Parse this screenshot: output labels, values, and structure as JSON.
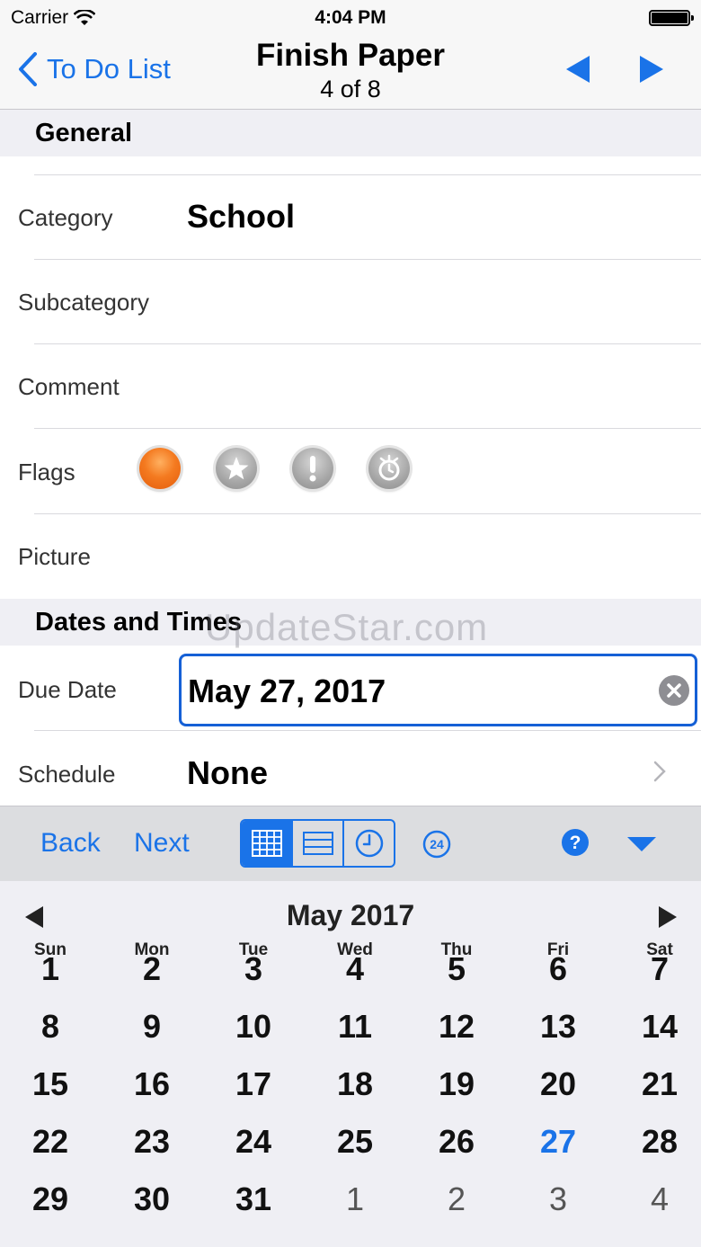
{
  "status": {
    "carrier": "Carrier",
    "time": "4:04 PM"
  },
  "nav": {
    "back_label": "To Do List",
    "title": "Finish Paper",
    "subtitle": "4 of 8"
  },
  "sections": {
    "general": "General",
    "dates": "Dates and Times"
  },
  "fields": {
    "category": {
      "label": "Category",
      "value": "School"
    },
    "subcategory": {
      "label": "Subcategory",
      "value": ""
    },
    "comment": {
      "label": "Comment",
      "value": ""
    },
    "flags": {
      "label": "Flags",
      "icons": [
        "orange-flag-icon",
        "star-flag-icon",
        "exclamation-flag-icon",
        "alarm-flag-icon"
      ]
    },
    "picture": {
      "label": "Picture"
    },
    "due_date": {
      "label": "Due Date",
      "value": "May 27, 2017"
    },
    "schedule": {
      "label": "Schedule",
      "value": "None"
    }
  },
  "watermark": "UpdateStar.com",
  "toolbar": {
    "back": "Back",
    "next": "Next",
    "active_view": "month-grid"
  },
  "calendar": {
    "month": "May 2017",
    "weekdays": [
      "Sun",
      "Mon",
      "Tue",
      "Wed",
      "Thu",
      "Fri",
      "Sat"
    ],
    "weeks": [
      [
        "1",
        "2",
        "3",
        "4",
        "5",
        "6",
        "7"
      ],
      [
        "8",
        "9",
        "10",
        "11",
        "12",
        "13",
        "14"
      ],
      [
        "15",
        "16",
        "17",
        "18",
        "19",
        "20",
        "21"
      ],
      [
        "22",
        "23",
        "24",
        "25",
        "26",
        "27",
        "28"
      ],
      [
        "29",
        "30",
        "31",
        "1",
        "2",
        "3",
        "4"
      ]
    ],
    "selected": "27"
  },
  "colors": {
    "accent": "#1a73e8",
    "flag_orange": "#f47a20",
    "section_bg": "#efeff4"
  }
}
